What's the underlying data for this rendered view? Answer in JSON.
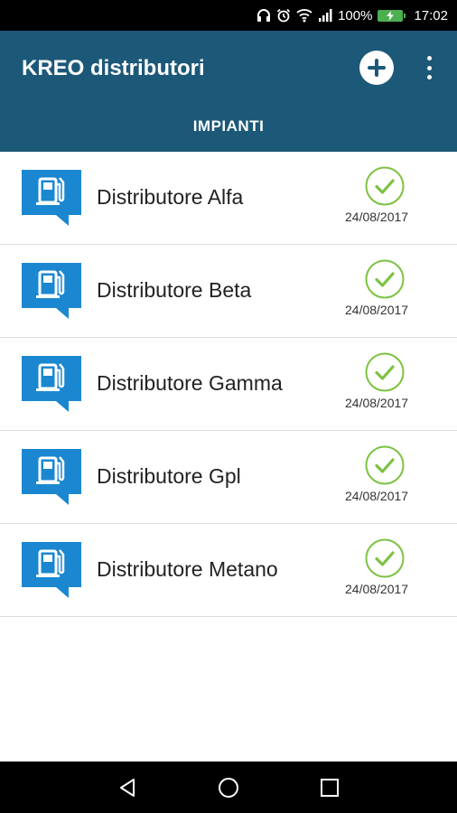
{
  "status_bar": {
    "battery_percent": "100%",
    "time": "17:02",
    "battery_color": "#4caf50",
    "icons": [
      "headset-icon",
      "alarm-icon",
      "wifi-icon",
      "signal-icon",
      "battery-icon"
    ]
  },
  "app_bar": {
    "title": "KREO distributori",
    "background": "#1c5878",
    "actions": [
      "add-icon",
      "more-vert-icon"
    ]
  },
  "tabs": [
    {
      "label": "IMPIANTI",
      "selected": true
    }
  ],
  "list": {
    "items": [
      {
        "name": "Distributore Alfa",
        "date": "24/08/2017",
        "status": "ok",
        "icon": "fuel-pump-icon"
      },
      {
        "name": "Distributore Beta",
        "date": "24/08/2017",
        "status": "ok",
        "icon": "fuel-pump-icon"
      },
      {
        "name": "Distributore Gamma",
        "date": "24/08/2017",
        "status": "ok",
        "icon": "fuel-pump-icon"
      },
      {
        "name": "Distributore Gpl",
        "date": "24/08/2017",
        "status": "ok",
        "icon": "fuel-pump-icon"
      },
      {
        "name": "Distributore Metano",
        "date": "24/08/2017",
        "status": "ok",
        "icon": "fuel-pump-icon"
      }
    ],
    "icon_color": "#1a87d0",
    "check_color": "#7cc242"
  },
  "nav_bar": {
    "buttons": [
      "back-icon",
      "home-icon",
      "recents-icon"
    ]
  }
}
